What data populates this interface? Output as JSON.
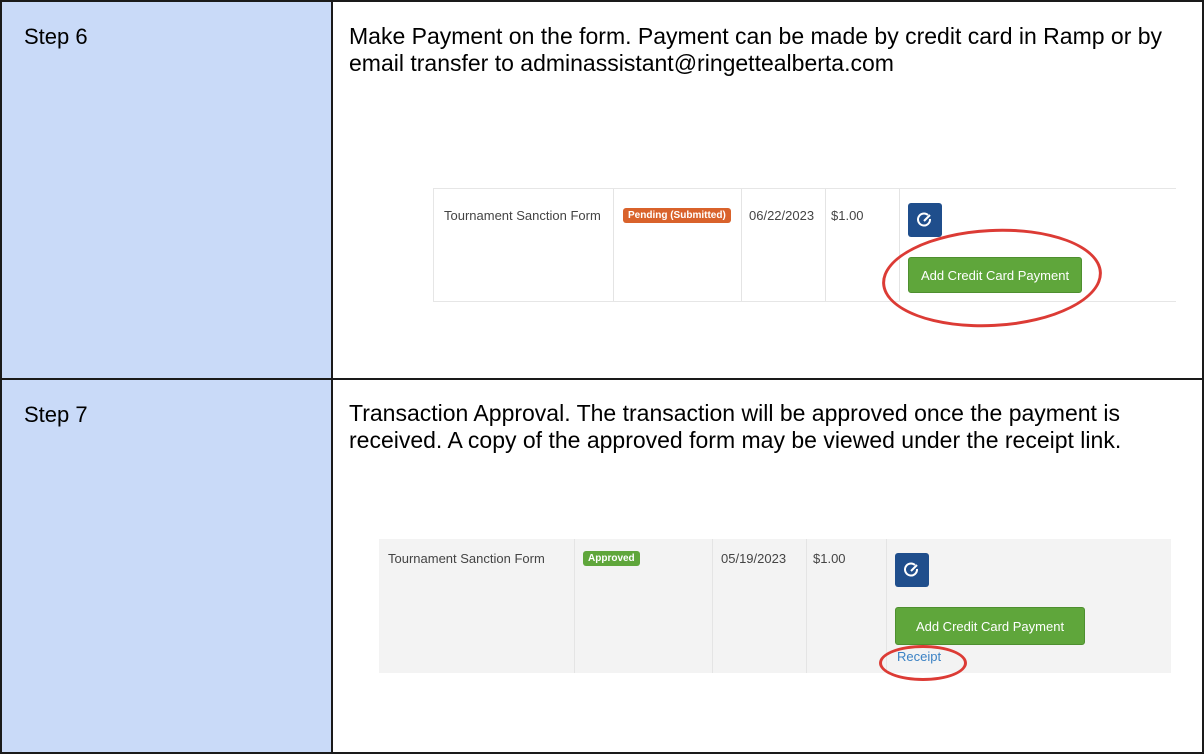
{
  "steps": [
    {
      "label": "Step 6",
      "text": "Make Payment on the form. Payment can be made by credit card in Ramp or by email transfer to adminassistant@ringettealberta.com",
      "screenshot": {
        "form_name": "Tournament Sanction Form",
        "status": "Pending (Submitted)",
        "status_color": "#d9622b",
        "date": "06/22/2023",
        "amount": "$1.00",
        "edit_icon": "edit-icon",
        "payment_button": "Add Credit Card Payment"
      }
    },
    {
      "label": "Step 7",
      "text": "Transaction Approval. The transaction will be approved once the payment is received. A copy of the approved form may be viewed under the receipt link.",
      "screenshot": {
        "form_name": "Tournament Sanction Form",
        "status": "Approved",
        "status_color": "#5fa63b",
        "date": "05/19/2023",
        "amount": "$1.00",
        "edit_icon": "edit-icon",
        "payment_button": "Add Credit Card Payment",
        "receipt_link": "Receipt"
      }
    }
  ],
  "highlight_color": "#dc3b35"
}
